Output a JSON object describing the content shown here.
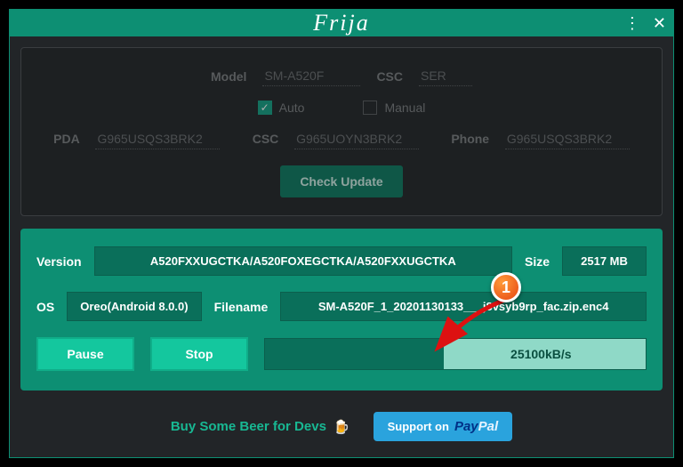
{
  "title": "Frija",
  "top": {
    "model_label": "Model",
    "model_value": "SM-A520F",
    "csc_label": "CSC",
    "csc_value": "SER",
    "auto_label": "Auto",
    "auto_checked": true,
    "manual_label": "Manual",
    "manual_checked": false,
    "pda_label": "PDA",
    "pda_value": "G965USQS3BRK2",
    "csc2_label": "CSC",
    "csc2_value": "G965UOYN3BRK2",
    "phone_label": "Phone",
    "phone_value": "G965USQS3BRK2",
    "check_label": "Check Update"
  },
  "dl": {
    "version_label": "Version",
    "version_value": "A520FXXUGCTKA/A520FOXEGCTKA/A520FXXUGCTKA",
    "size_label": "Size",
    "size_value": "2517 MB",
    "os_label": "OS",
    "os_value": "Oreo(Android 8.0.0)",
    "filename_label": "Filename",
    "filename_value": "SM-A520F_1_20201130133___j8vsyb9rp_fac.zip.enc4",
    "pause_label": "Pause",
    "stop_label": "Stop",
    "speed": "25100kB/s"
  },
  "footer": {
    "beer": "Buy Some Beer for Devs",
    "support": "Support on",
    "paypal": "PayPal"
  },
  "annotation": {
    "badge": "1"
  }
}
